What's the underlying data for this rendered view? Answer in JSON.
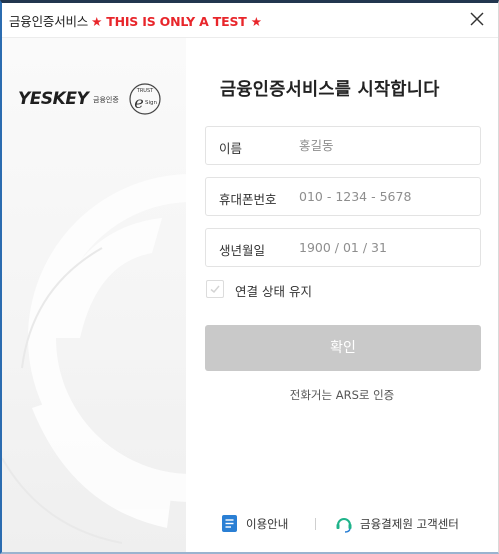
{
  "window": {
    "title": "금융인증서비스",
    "test_notice": "★ THIS IS ONLY A TEST ★",
    "close_glyph": "✕"
  },
  "logo": {
    "brand": "YESKEY",
    "brand_sub": "금융인증",
    "trust": "TRUST",
    "esign_e": "e",
    "esign_sign": "Sign"
  },
  "form": {
    "heading": "금융인증서비스를 시작합니다",
    "fields": [
      {
        "label": "이름",
        "placeholder": "홍길동"
      },
      {
        "label": "휴대폰번호",
        "placeholder": "010 - 1234 - 5678"
      },
      {
        "label": "생년월일",
        "placeholder": "1900 / 01 / 31"
      }
    ],
    "remember_label": "연결 상태 유지",
    "remember_checked": false,
    "confirm_label": "확인",
    "ars_link": "전화거는 ARS로 인증"
  },
  "footer": {
    "guide_label": "이용안내",
    "support_label": "금융결제원 고객센터"
  },
  "colors": {
    "accent_blue": "#2a7fd4",
    "warning_red": "#e8262b",
    "button_disabled": "#c9c9c9",
    "support_icon_green": "#1fb38a"
  }
}
